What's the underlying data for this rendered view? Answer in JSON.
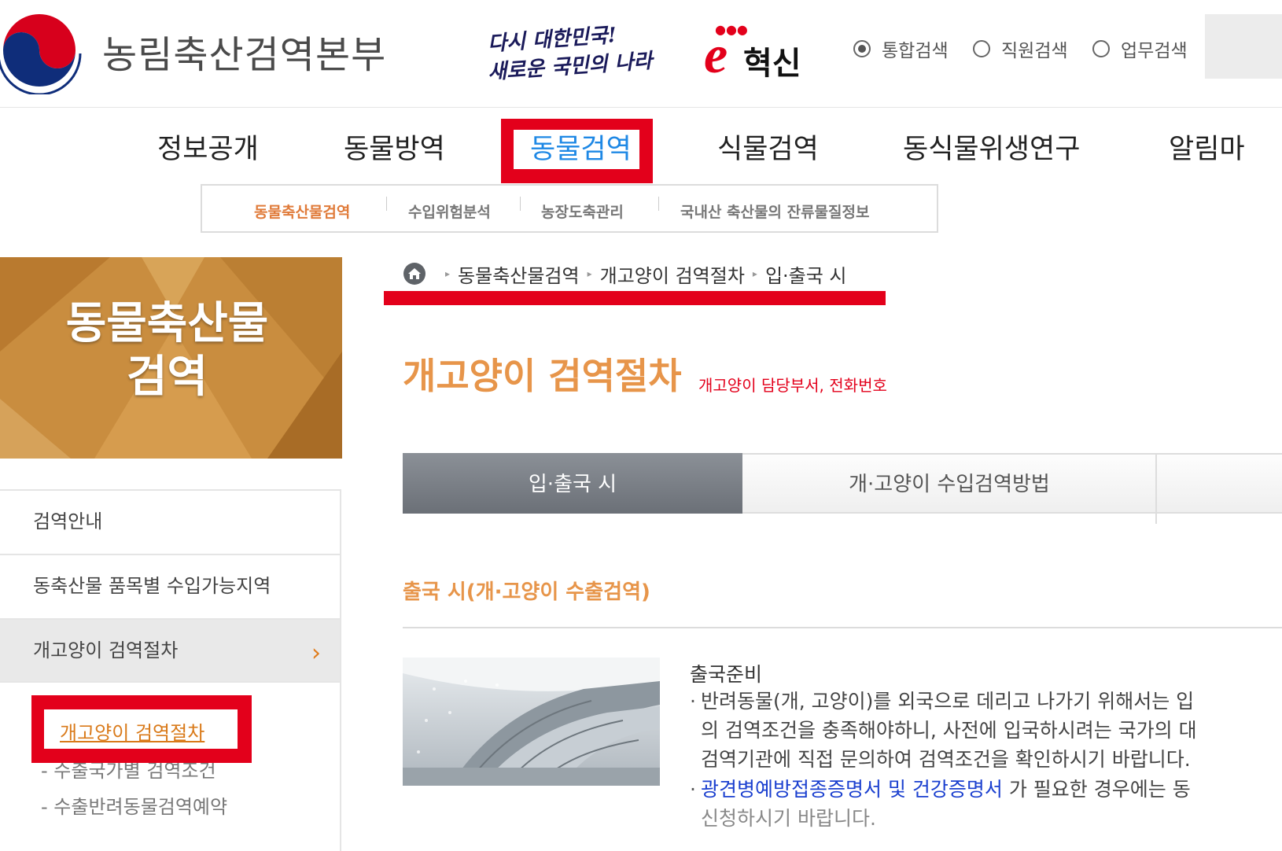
{
  "header": {
    "org_name": "농림축산검역본부",
    "slogan_line1": "다시 대한민국!",
    "slogan_line2": "새로운 국민의 나라",
    "innovation_text": "혁신",
    "innovation_letter": "e",
    "search_options": [
      {
        "label": "통합검색",
        "selected": true
      },
      {
        "label": "직원검색",
        "selected": false
      },
      {
        "label": "업무검색",
        "selected": false
      }
    ]
  },
  "gnb": {
    "items": [
      "정보공개",
      "동물방역",
      "동물검역",
      "식물검역",
      "동식물위생연구",
      "알림마"
    ],
    "active": "동물검역",
    "highlight_color": "#e3001b"
  },
  "submenu": {
    "items": [
      "동물축산물검역",
      "수입위험분석",
      "농장도축관리",
      "국내산 축산물의 잔류물질정보"
    ],
    "active_color": "#e07b3a"
  },
  "left_banner": {
    "title_line1": "동물축산물",
    "title_line2": "검역"
  },
  "left_menu": {
    "items": [
      "검역안내",
      "동축산물 품목별 수입가능지역",
      "개고양이 검역절차"
    ],
    "active_index": 2,
    "sub_items": [
      "개고양이 검역절차",
      "수출국가별 검역조건",
      "수출반려동물검역예약"
    ]
  },
  "breadcrumb": [
    "동물축산물검역",
    "개고양이 검역절차",
    "입·출국 시"
  ],
  "page": {
    "title": "개고양이 검역절차",
    "dept_link": "개고양이 담당부서, 전화번호",
    "accent_color": "#e7954a"
  },
  "tabs": [
    "입·출국 시",
    "개·고양이 수입검역방법"
  ],
  "section": {
    "title": "출국 시(개·고양이 수출검역)",
    "prep_title": "출국준비",
    "lines": [
      "반려동물(개, 고양이)를 외국으로 데리고 나가기 위해서는 입",
      "의 검역조건을 충족해야하니, 사전에 입국하시려는 국가의 대",
      "검역기관에 직접 문의하여 검역조건을 확인하시기 바랍니다."
    ],
    "link_text": "광견병예방접종증명서 및 건강증명서",
    "link_suffix": " 가 필요한 경우에는 동",
    "last_line": "신청하시기 바랍니다."
  }
}
